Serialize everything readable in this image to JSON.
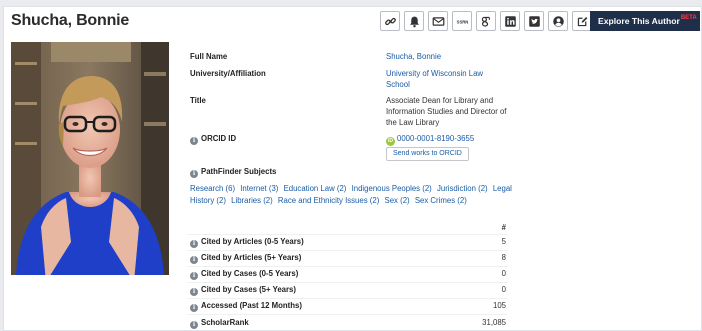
{
  "author": {
    "name": "Shucha, Bonnie"
  },
  "toolbar": {
    "icons": [
      "link-icon",
      "bell-icon",
      "envelope-icon",
      "ssrn-icon",
      "google-scholar-icon",
      "linkedin-icon",
      "twitter-icon",
      "user-circle-icon",
      "edit-icon"
    ],
    "ssrn_text": "SSRN",
    "explore_label": "Explore This Author",
    "beta_label": "BETA"
  },
  "profile": {
    "full_name_label": "Full Name",
    "full_name": "Shucha, Bonnie",
    "affiliation_label": "University/Affiliation",
    "affiliation": "University of Wisconsin Law School",
    "title_label": "Title",
    "title": "Associate Dean for Library and Information Studies and Director of the Law Library",
    "orcid_label": "ORCID ID",
    "orcid": "0000-0001-8190-3655",
    "orcid_badge": "iD",
    "send_orcid_label": "Send works to ORCID"
  },
  "subjects": {
    "label": "PathFinder Subjects",
    "items": [
      "Research (6)",
      "Internet (3)",
      "Education Law (2)",
      "Indigenous Peoples (2)",
      "Jurisdiction (2)",
      "Legal History (2)",
      "Libraries (2)",
      "Race and Ethnicity Issues (2)",
      "Sex (2)",
      "Sex Crimes (2)"
    ]
  },
  "metrics": {
    "header": "#",
    "rows": [
      {
        "label": "Cited by Articles (0-5 Years)",
        "value": "5"
      },
      {
        "label": "Cited by Articles (5+ Years)",
        "value": "8"
      },
      {
        "label": "Cited by Cases (0-5 Years)",
        "value": "0"
      },
      {
        "label": "Cited by Cases (5+ Years)",
        "value": "0"
      },
      {
        "label": "Accessed (Past 12 Months)",
        "value": "105"
      },
      {
        "label": "ScholarRank",
        "value": "31,085"
      }
    ]
  },
  "colors": {
    "link": "#1a5ca6",
    "explore_bg": "#1f2f4a",
    "beta": "#ff3b3b",
    "orcid": "#9cc83a"
  }
}
